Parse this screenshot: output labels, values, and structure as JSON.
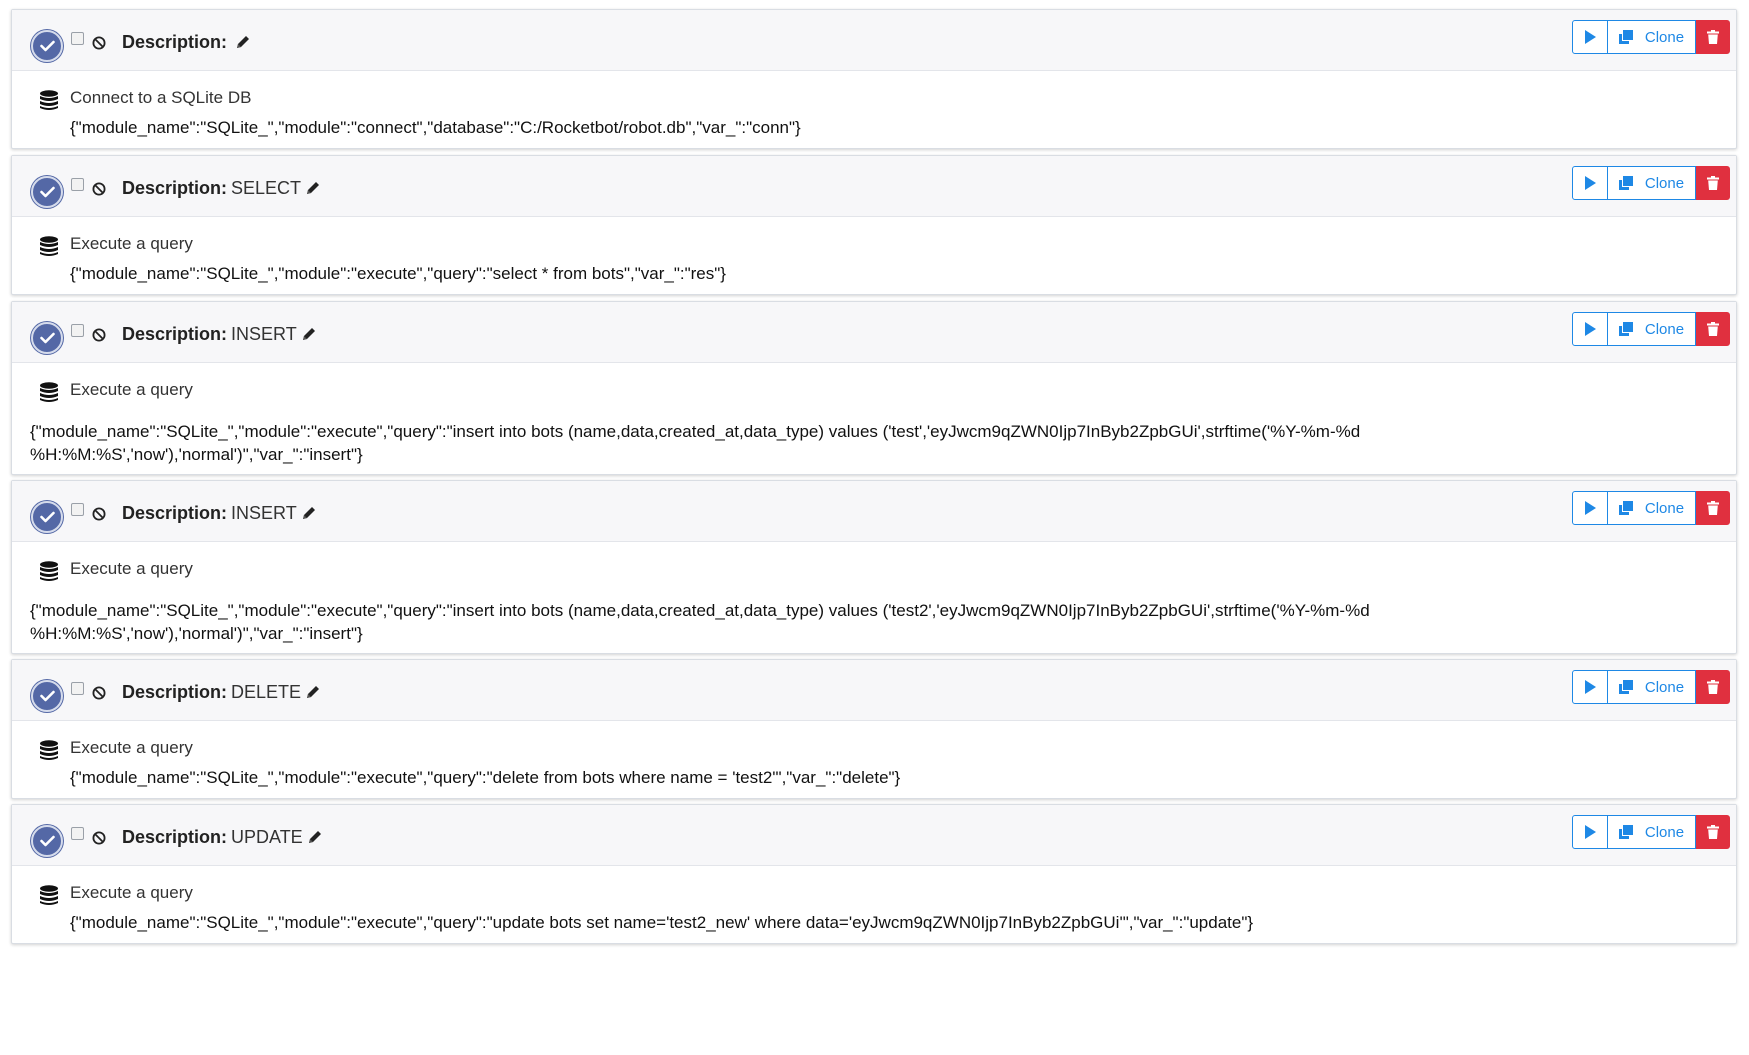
{
  "steps": [
    {
      "description_label": "Description:",
      "description": "",
      "module_title": "Connect to a SQLite DB",
      "json": "{\"module_name\":\"SQLite_\",\"module\":\"connect\",\"database\":\"C:/Rocketbot/robot.db\",\"var_\":\"conn\"}",
      "clone_label": "Clone"
    },
    {
      "description_label": "Description:",
      "description": "SELECT",
      "module_title": "Execute a query",
      "json": "{\"module_name\":\"SQLite_\",\"module\":\"execute\",\"query\":\"select * from bots\",\"var_\":\"res\"}",
      "clone_label": "Clone"
    },
    {
      "description_label": "Description:",
      "description": "INSERT",
      "module_title": "Execute a query",
      "json": "{\"module_name\":\"SQLite_\",\"module\":\"execute\",\"query\":\"insert into bots (name,data,created_at,data_type) values ('test','eyJwcm9qZWN0Ijp7InByb2ZpbGUi',strftime('%Y-%m-%d %H:%M:%S','now'),'normal')\",\"var_\":\"insert\"}",
      "clone_label": "Clone"
    },
    {
      "description_label": "Description:",
      "description": "INSERT",
      "module_title": "Execute a query",
      "json": "{\"module_name\":\"SQLite_\",\"module\":\"execute\",\"query\":\"insert into bots (name,data,created_at,data_type) values ('test2','eyJwcm9qZWN0Ijp7InByb2ZpbGUi',strftime('%Y-%m-%d %H:%M:%S','now'),'normal')\",\"var_\":\"insert\"}",
      "clone_label": "Clone"
    },
    {
      "description_label": "Description:",
      "description": "DELETE",
      "module_title": "Execute a query",
      "json": "{\"module_name\":\"SQLite_\",\"module\":\"execute\",\"query\":\"delete from bots where name = 'test2'\",\"var_\":\"delete\"}",
      "clone_label": "Clone"
    },
    {
      "description_label": "Description:",
      "description": "UPDATE",
      "module_title": "Execute a query",
      "json": "{\"module_name\":\"SQLite_\",\"module\":\"execute\",\"query\":\"update bots set name='test2_new' where data='eyJwcm9qZWN0Ijp7InByb2ZpbGUi'\",\"var_\":\"update\"}",
      "clone_label": "Clone"
    }
  ],
  "colors": {
    "accent": "#1e88e5",
    "danger": "#e0303f",
    "check": "#5468a6",
    "header_bg": "#f7f7f9"
  },
  "icons": {
    "enabled": "check-circle-icon",
    "disable": "ban-icon",
    "edit": "pencil-icon",
    "run": "play-icon",
    "clone": "clone-icon",
    "delete": "trash-icon",
    "module": "database-icon"
  }
}
